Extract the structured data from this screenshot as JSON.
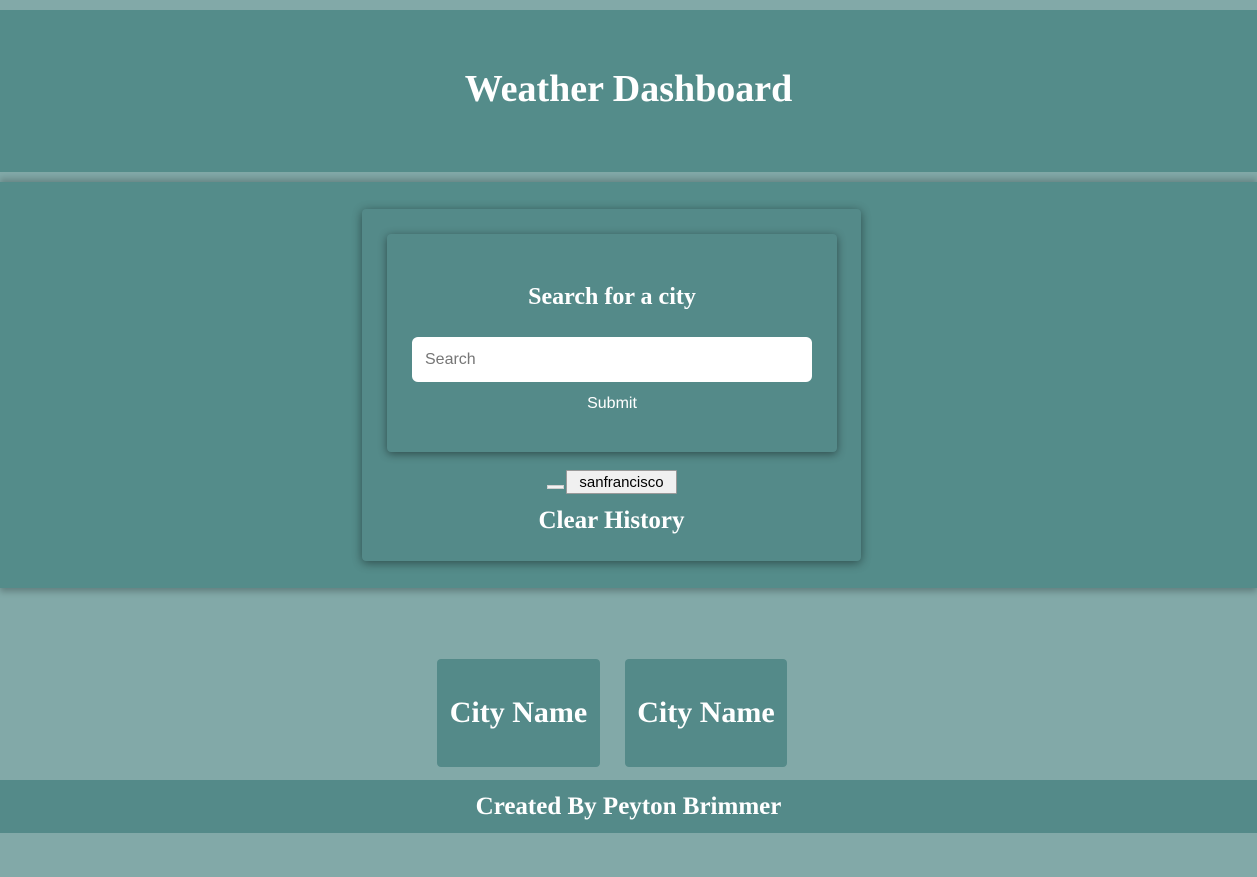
{
  "header": {
    "title": "Weather Dashboard"
  },
  "search": {
    "title": "Search for a city",
    "placeholder": "Search",
    "value": "",
    "submit_label": "Submit"
  },
  "history": {
    "items": [
      {
        "label": "sanfrancisco"
      }
    ],
    "clear_label": "Clear History"
  },
  "cities": [
    {
      "name": "City Name"
    },
    {
      "name": "City Name"
    }
  ],
  "footer": {
    "text": "Created By Peyton Brimmer"
  },
  "colors": {
    "background": "#82a9a8",
    "panel": "#548c8a",
    "text": "#ffffff"
  }
}
